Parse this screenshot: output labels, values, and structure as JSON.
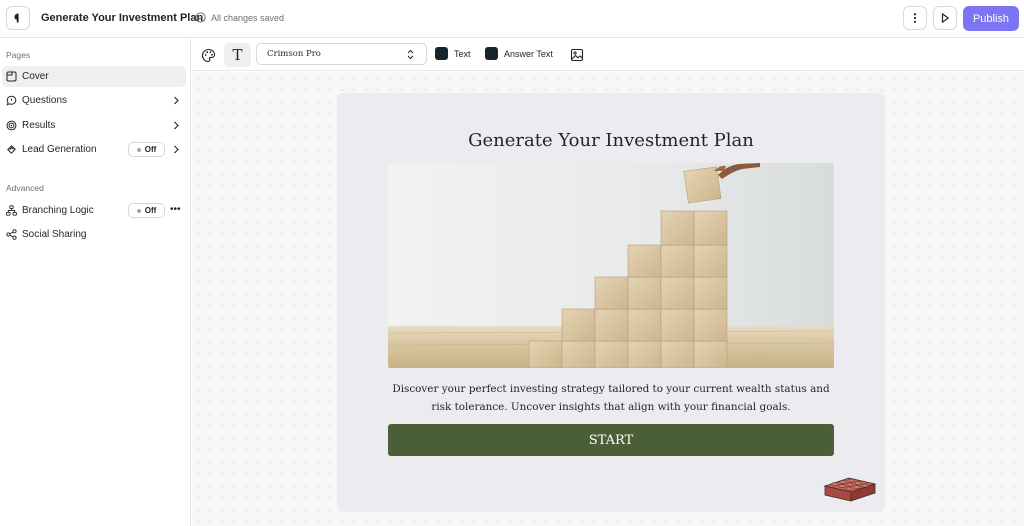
{
  "header": {
    "title": "Generate Your Investment Plan",
    "save_status": "All changes saved",
    "publish_label": "Publish",
    "icons": [
      "logo-icon",
      "check-circle-icon",
      "more-vertical-icon",
      "play-icon"
    ]
  },
  "sidebar": {
    "pages_label": "Pages",
    "pages": [
      {
        "label": "Cover",
        "icon": "cover-icon",
        "active": true
      },
      {
        "label": "Questions",
        "icon": "message-icon"
      },
      {
        "label": "Results",
        "icon": "results-icon"
      },
      {
        "label": "Lead Generation",
        "icon": "magnet-icon",
        "toggle": "Off"
      }
    ],
    "advanced_label": "Advanced",
    "advanced": [
      {
        "label": "Branching Logic",
        "icon": "branch-icon",
        "toggle": "Off"
      },
      {
        "label": "Social Sharing",
        "icon": "share-icon"
      }
    ]
  },
  "toolbar": {
    "font": "Crimson Pro",
    "text_color_label": "Text",
    "answer_color_label": "Answer Text",
    "text_color": "#18242b",
    "answer_color": "#18242b",
    "icons": [
      "palette-icon",
      "type-icon",
      "image-icon"
    ]
  },
  "cover": {
    "title": "Generate Your Investment Plan",
    "description": "Discover your perfect investing strategy tailored to your current wealth status and risk tolerance. Uncover insights that align with your financial goals.",
    "start_label": "START",
    "button_color": "#4a5f38",
    "card_color": "#ececf0"
  },
  "colors": {
    "accent": "#7c74f2"
  }
}
